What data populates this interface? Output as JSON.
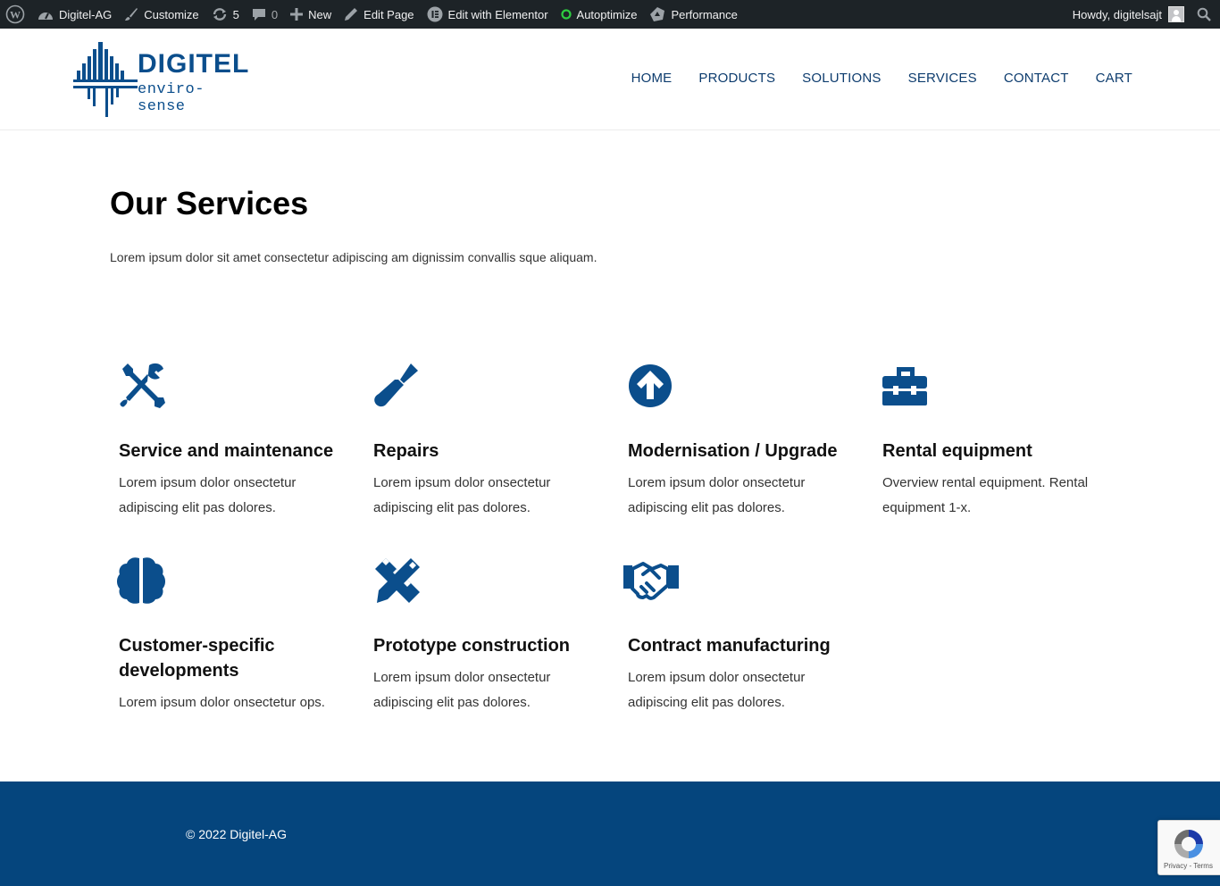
{
  "adminbar": {
    "site_name": "Digitel-AG",
    "customize": "Customize",
    "updates_count": "5",
    "comments_count": "0",
    "new": "New",
    "edit_page": "Edit Page",
    "edit_elementor": "Edit with Elementor",
    "autoptimize": "Autoptimize",
    "performance": "Performance",
    "howdy": "Howdy, digitelsajt"
  },
  "brand": {
    "name": "DIGITEL",
    "tagline": "enviro-sense",
    "color": "#0b4e8c"
  },
  "nav": {
    "items": [
      "HOME",
      "PRODUCTS",
      "SOLUTIONS",
      "SERVICES",
      "CONTACT",
      "CART"
    ]
  },
  "page": {
    "title": "Our Services",
    "intro": "Lorem ipsum dolor sit amet consectetur adipiscing am dignissim convallis sque aliquam."
  },
  "services": [
    {
      "icon": "tools-icon",
      "title": "Service and maintenance",
      "desc": "Lorem ipsum dolor onsectetur adipiscing elit pas dolores."
    },
    {
      "icon": "screwdriver-icon",
      "title": "Repairs",
      "desc": "Lorem ipsum dolor onsectetur adipiscing elit pas dolores."
    },
    {
      "icon": "arrow-circle-up-icon",
      "title": "Modernisation / Upgrade",
      "desc": "Lorem ipsum dolor onsectetur adipiscing elit pas dolores."
    },
    {
      "icon": "toolbox-icon",
      "title": "Rental equipment",
      "desc": "Overview rental equipment. Rental equipment 1-x."
    },
    {
      "icon": "brain-icon",
      "title": "Customer-specific developments",
      "desc": "Lorem ipsum dolor onsectetur ops."
    },
    {
      "icon": "pencil-ruler-icon",
      "title": "Prototype construction",
      "desc": "Lorem ipsum dolor onsectetur adipiscing elit pas dolores."
    },
    {
      "icon": "handshake-icon",
      "title": "Contract manufacturing",
      "desc": "Lorem ipsum dolor onsectetur adipiscing elit pas dolores."
    }
  ],
  "footer": {
    "copyright": "© 2022 Digitel-AG",
    "background": "#05457d"
  },
  "recaptcha": {
    "links": "Privacy - Terms"
  }
}
